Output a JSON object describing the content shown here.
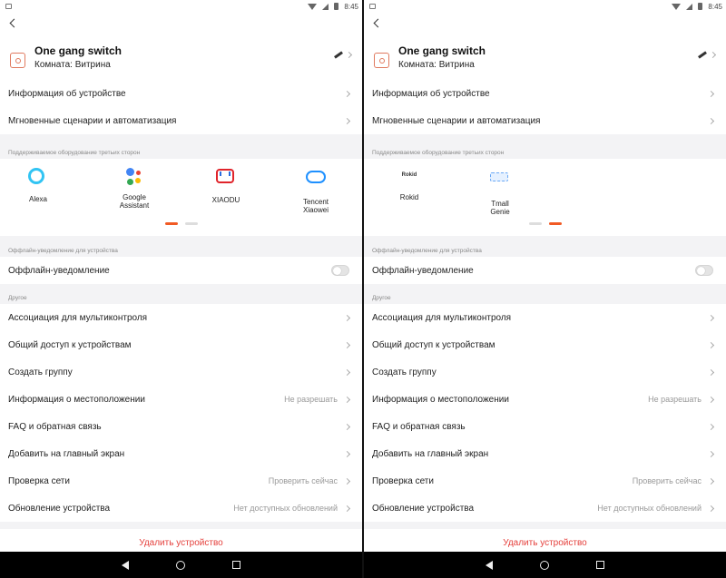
{
  "status": {
    "time": "8:45"
  },
  "device": {
    "name": "One gang switch",
    "room": "Комната: Витрина"
  },
  "rows_top": [
    {
      "label": "Информация об устройстве"
    },
    {
      "label": "Мгновенные сценарии и автоматизация"
    }
  ],
  "sections": {
    "third_party": "Поддерживаемое оборудование третьих сторон",
    "offline": "Оффлайн-уведомление для устройства",
    "other": "Другое"
  },
  "third_party_left": [
    {
      "name": "Alexa",
      "icon": "alexa-icon"
    },
    {
      "name": "Google\nAssistant",
      "icon": "google-assistant-icon"
    },
    {
      "name": "XIAODU",
      "icon": "xiaodu-icon"
    },
    {
      "name": "Tencent\nXiaowei",
      "icon": "tencent-xiaowei-icon"
    }
  ],
  "third_party_right": [
    {
      "name": "Rokid",
      "icon": "rokid-icon",
      "logo_text": "Rokid"
    },
    {
      "name": "Tmall\nGenie",
      "icon": "tmall-genie-icon"
    }
  ],
  "offline_row": {
    "label": "Оффлайн-уведомление",
    "enabled": false
  },
  "rows_other": [
    {
      "label": "Ассоциация для мультиконтроля",
      "value": ""
    },
    {
      "label": "Общий доступ к устройствам",
      "value": ""
    },
    {
      "label": "Создать группу",
      "value": ""
    },
    {
      "label": "Информация о местоположении",
      "value": "Не разрешать"
    },
    {
      "label": "FAQ и обратная связь",
      "value": ""
    },
    {
      "label": "Добавить на главный экран",
      "value": ""
    },
    {
      "label": "Проверка сети",
      "value": "Проверить сейчас"
    },
    {
      "label": "Обновление устройства",
      "value": "Нет доступных обновлений"
    }
  ],
  "delete_label": "Удалить устройство",
  "colors": {
    "accent": "#f15a24",
    "danger": "#e5413d",
    "section_bg": "#f3f3f5"
  }
}
